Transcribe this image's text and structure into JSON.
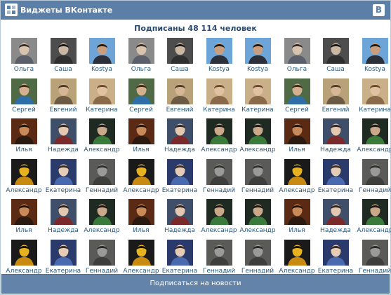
{
  "header": {
    "title": "Виджеты ВКонтакте",
    "badge": "B",
    "logo_icon": "vk-widgets-logo-icon",
    "colors": {
      "bar": "#5b7fa6",
      "text": "#ffffff"
    }
  },
  "subscribers": {
    "count_text": "Подписаны 48 114 человек"
  },
  "people": {
    "Ольга": {
      "avatar_icon": "person-photo-icon",
      "bg": "#8a8a8a",
      "skin": "#d8c4ae",
      "shirt": "#5a5f6a",
      "hair": "#3a2d24"
    },
    "Саша": {
      "avatar_icon": "person-photo-icon",
      "bg": "#4d4d4d",
      "skin": "#c9b7a4",
      "shirt": "#2f2f2f",
      "hair": "#1a1a1a"
    },
    "Kostya": {
      "avatar_icon": "person-photo-icon",
      "bg": "#6da5d8",
      "skin": "#c89e7e",
      "shirt": "#2a2f3a",
      "hair": "#1e1b18"
    },
    "Сергей": {
      "avatar_icon": "person-photo-icon",
      "bg": "#4f6a45",
      "skin": "#d4b090",
      "shirt": "#2f6fa8",
      "hair": "#3a2a1a"
    },
    "Евгений": {
      "avatar_icon": "person-photo-icon",
      "bg": "#b9a27a",
      "skin": "#d6b694",
      "shirt": "#6d5a44",
      "hair": "#4a3a2a"
    },
    "Катерина": {
      "avatar_icon": "person-photo-icon",
      "bg": "#c9b089",
      "skin": "#e0c2a2",
      "shirt": "#8a6a4a",
      "hair": "#6b4a2a"
    },
    "Илья": {
      "avatar_icon": "person-photo-icon",
      "bg": "#5a2a14",
      "skin": "#c98a5a",
      "shirt": "#2a1a10",
      "hair": "#1a100a"
    },
    "Надежда": {
      "avatar_icon": "person-photo-icon",
      "bg": "#3f4f6a",
      "skin": "#e2c8b0",
      "shirt": "#7a2a2a",
      "hair": "#2a2020"
    },
    "Александр": {
      "avatar_icon": "person-photo-icon",
      "bg": "#1f2a22",
      "skin": "#caa88a",
      "shirt": "#3a7a3a",
      "hair": "#151515"
    },
    "Екатерина": {
      "avatar_icon": "person-photo-icon",
      "bg": "#2a3a6a",
      "skin": "#e4ccb6",
      "shirt": "#4a6ab0",
      "hair": "#3a2a22"
    },
    "Геннадий": {
      "avatar_icon": "person-photo-icon",
      "bg": "#5a5a58",
      "skin": "#9a9a96",
      "shirt": "#3e3e3c",
      "hair": "#2a2a28"
    },
    "Александр*": {
      "avatar_icon": "person-photo-icon",
      "bg": "#1a1a1a",
      "skin": "#e7b220",
      "shirt": "#c88a10",
      "hair": "#111111"
    }
  },
  "grid": [
    [
      "Ольга",
      "Саша",
      "Kostya",
      "Ольга",
      "Саша",
      "Kostya",
      "Kostya",
      "Ольга",
      "Саша",
      "Kostya"
    ],
    [
      "Сергей",
      "Евгений",
      "Катерина",
      "Сергей",
      "Евгений",
      "Катерина",
      "Катерина",
      "Сергей",
      "Евгений",
      "Катерина"
    ],
    [
      "Илья",
      "Надежда",
      "Александр",
      "Илья",
      "Надежда",
      "Александр",
      "Александр",
      "Илья",
      "Надежда",
      "Александр"
    ],
    [
      "Александр",
      "Екатерина",
      "Геннадий",
      "Александр",
      "Екатерина",
      "Геннадий",
      "Геннадий",
      "Александр",
      "Екатерина",
      "Геннадий"
    ],
    [
      "Илья",
      "Надежда",
      "Александр",
      "Илья",
      "Надежда",
      "Александр",
      "Александр",
      "Илья",
      "Надежда",
      "Александр"
    ],
    [
      "Александр",
      "Екатерина",
      "Геннадий",
      "Александр",
      "Екатерина",
      "Геннадий",
      "Геннадий",
      "Александр",
      "Екатерина",
      "Геннадий"
    ]
  ],
  "subscribe_button": {
    "label": "Подписаться на новости"
  }
}
